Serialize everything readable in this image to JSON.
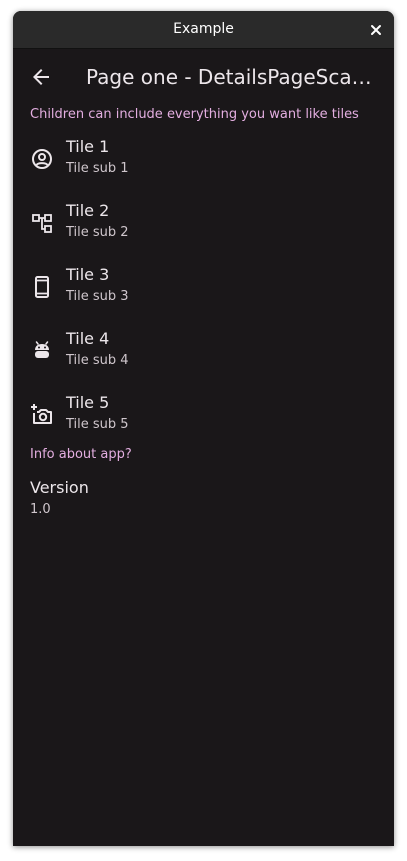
{
  "window": {
    "title": "Example"
  },
  "appbar": {
    "title": "Page one - DetailsPageScaffold"
  },
  "section1": {
    "header": "Children can include everything you want like tiles"
  },
  "tiles": [
    {
      "title": "Tile 1",
      "subtitle": "Tile sub 1",
      "icon": "account-circle-icon"
    },
    {
      "title": "Tile 2",
      "subtitle": "Tile sub 2",
      "icon": "account-tree-icon"
    },
    {
      "title": "Tile 3",
      "subtitle": "Tile sub 3",
      "icon": "phone-android-icon"
    },
    {
      "title": "Tile 4",
      "subtitle": "Tile sub 4",
      "icon": "android-icon"
    },
    {
      "title": "Tile 5",
      "subtitle": "Tile sub 5",
      "icon": "add-a-photo-icon"
    }
  ],
  "section2": {
    "header": "Info about app?",
    "version_title": "Version",
    "version_value": "1.0"
  },
  "colors": {
    "background": "#1a1719",
    "accent": "#e3aee0",
    "text": "#ece6ea"
  }
}
